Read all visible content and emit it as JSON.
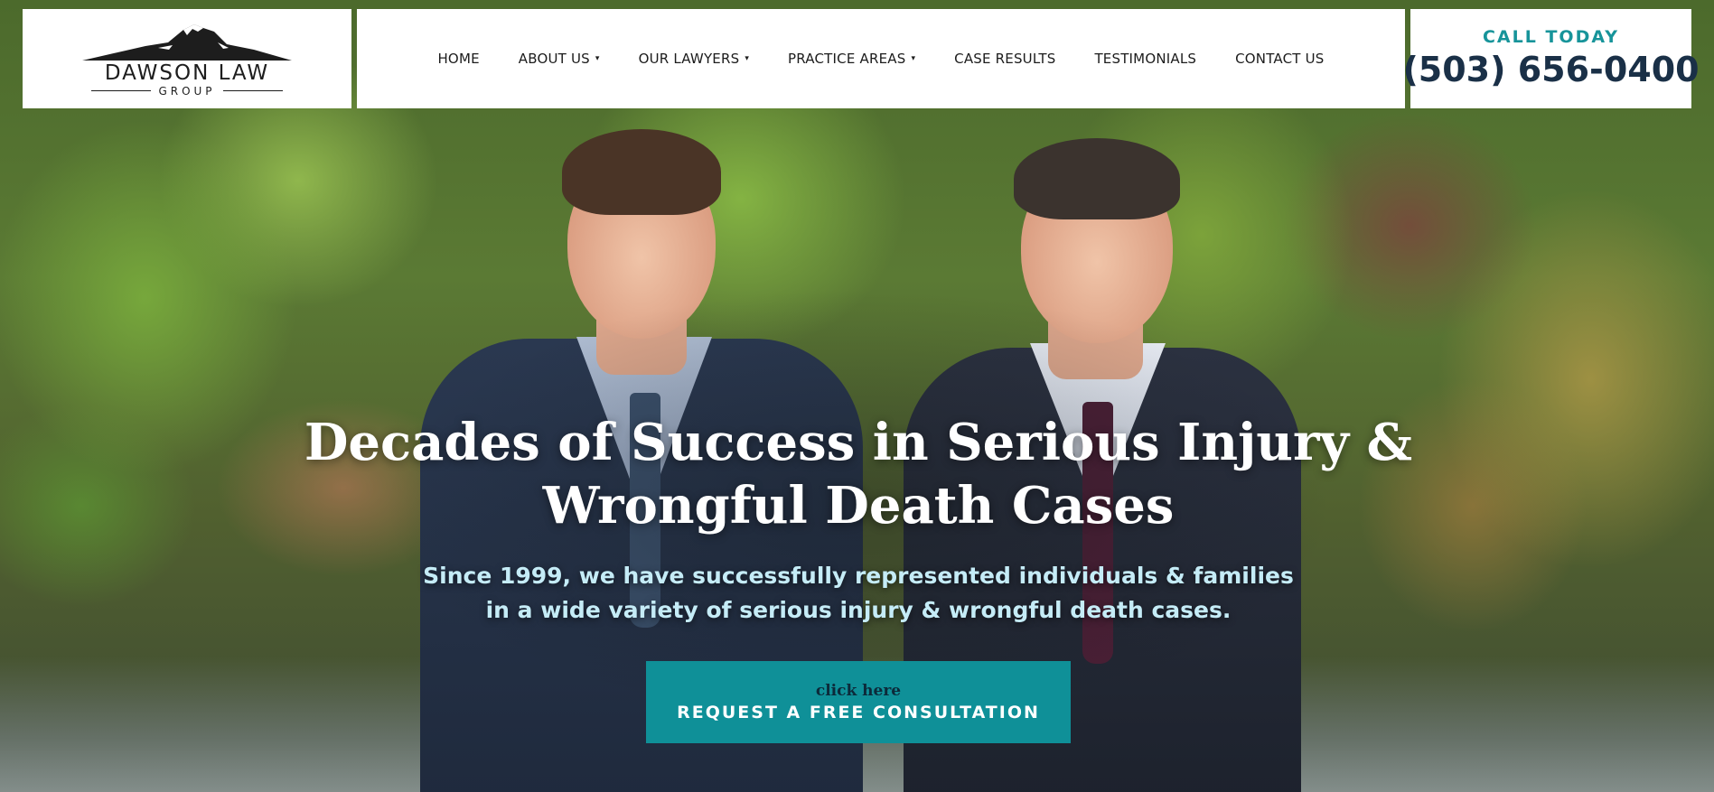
{
  "brand": {
    "name": "DAWSON LAW",
    "subtitle": "GROUP"
  },
  "nav": {
    "items": [
      {
        "label": "HOME",
        "has_dropdown": false
      },
      {
        "label": "ABOUT US",
        "has_dropdown": true
      },
      {
        "label": "OUR LAWYERS",
        "has_dropdown": true
      },
      {
        "label": "PRACTICE AREAS",
        "has_dropdown": true
      },
      {
        "label": "CASE RESULTS",
        "has_dropdown": false
      },
      {
        "label": "TESTIMONIALS",
        "has_dropdown": false
      },
      {
        "label": "CONTACT US",
        "has_dropdown": false
      }
    ],
    "caret": "▾"
  },
  "call": {
    "label": "CALL TODAY",
    "phone": "(503) 656-0400"
  },
  "hero": {
    "title_line1": "Decades of Success in Serious Injury &",
    "title_line2": "Wrongful Death Cases",
    "sub_line1": "Since 1999, we have successfully represented individuals & families",
    "sub_line2": "in a wide variety of serious injury & wrongful death cases.",
    "cta_small": "click here",
    "cta_main": "REQUEST A FREE CONSULTATION"
  },
  "colors": {
    "accent": "#0f9098",
    "call_label": "#17949a",
    "phone": "#1a3047",
    "hero_sub": "#c5ecf7",
    "header_bg": "#ffffff"
  },
  "icons": [
    "mountain-logo-icon",
    "dropdown-caret-icon"
  ]
}
